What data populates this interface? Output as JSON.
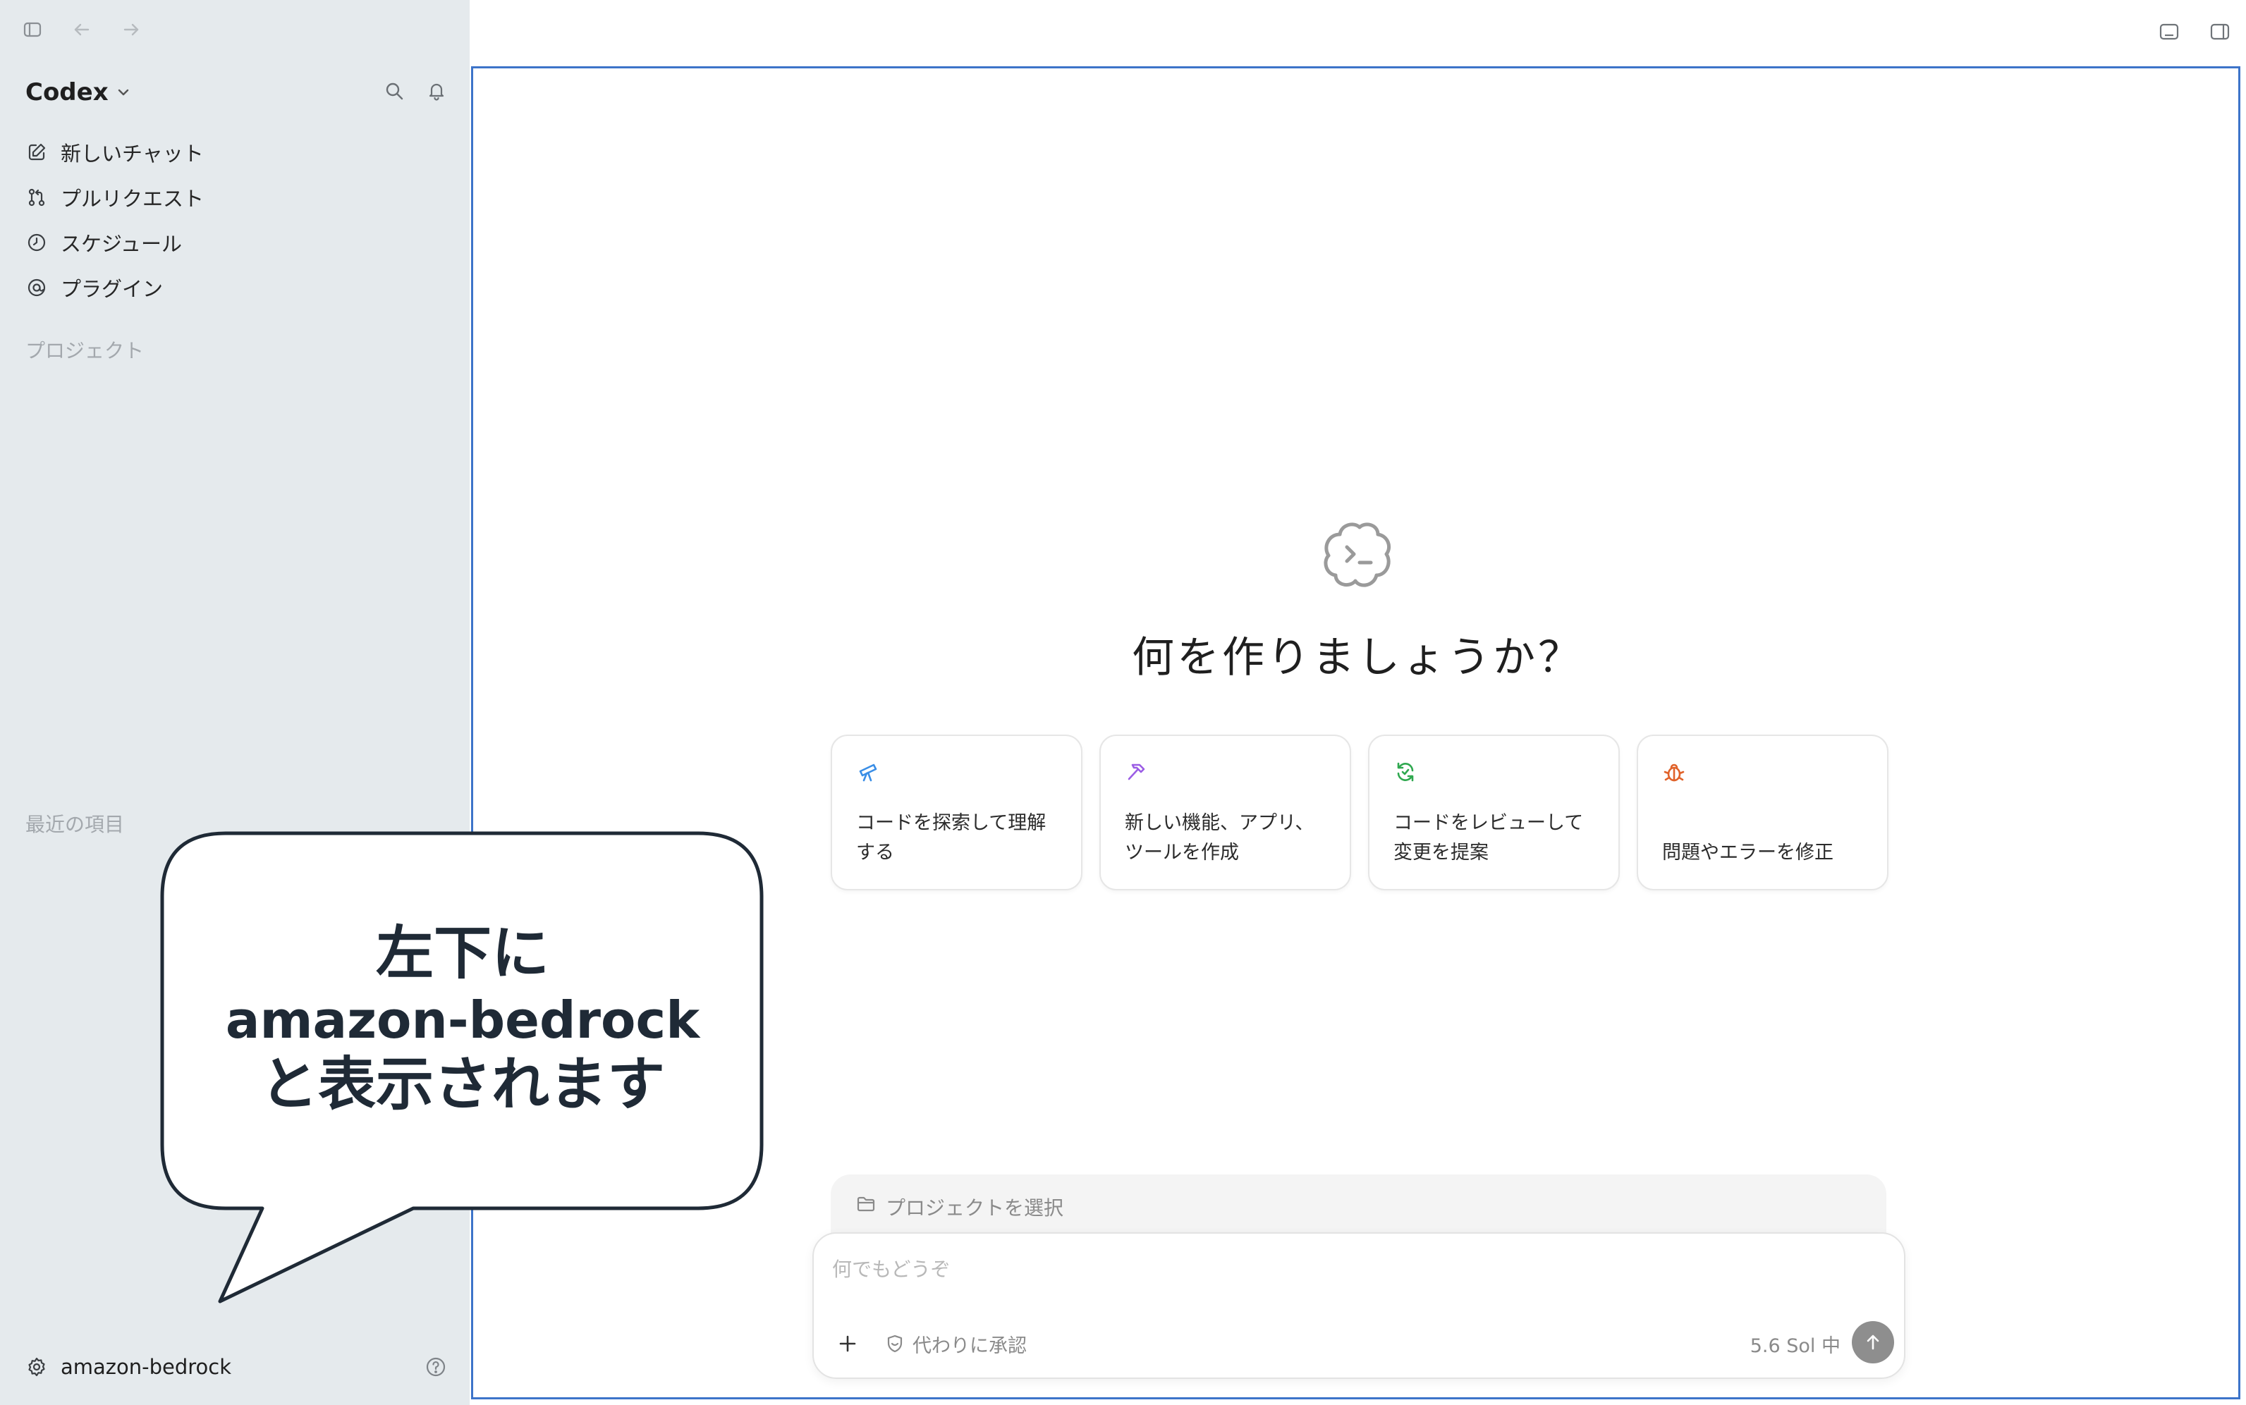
{
  "sidebar": {
    "app_title": "Codex",
    "nav": [
      {
        "label": "新しいチャット",
        "icon": "compose-icon"
      },
      {
        "label": "プルリクエスト",
        "icon": "pull-request-icon"
      },
      {
        "label": "スケジュール",
        "icon": "clock-icon"
      },
      {
        "label": "プラグイン",
        "icon": "plugin-icon"
      }
    ],
    "projects_label": "プロジェクト",
    "recent_label": "最近の項目",
    "account_name": "amazon-bedrock"
  },
  "main": {
    "hero_title": "何を作りましょうか？",
    "cards": [
      {
        "text": "コードを探索して理解\nする",
        "icon": "telescope-icon",
        "color": "#3a8ee6"
      },
      {
        "text": "新しい機能、アプリ、\nツールを作成",
        "icon": "hammer-icon",
        "color": "#9b5de5"
      },
      {
        "text": "コードをレビューして\n変更を提案",
        "icon": "review-refresh-icon",
        "color": "#2fa84f"
      },
      {
        "text": "問題やエラーを修正",
        "icon": "bug-icon",
        "color": "#e0622a"
      }
    ]
  },
  "composer": {
    "project_select_label": "プロジェクトを選択",
    "placeholder": "何でもどうぞ",
    "approve_label": "代わりに承認",
    "model_label": "5.6 Sol 中"
  },
  "callout": {
    "line1": "左下に",
    "line2": "amazon-bedrock",
    "line3": "と表示されます"
  },
  "colors": {
    "sidebar_bg": "#e5eaed",
    "frame_border": "#3d74c9",
    "send_button": "#8e8e8e"
  }
}
